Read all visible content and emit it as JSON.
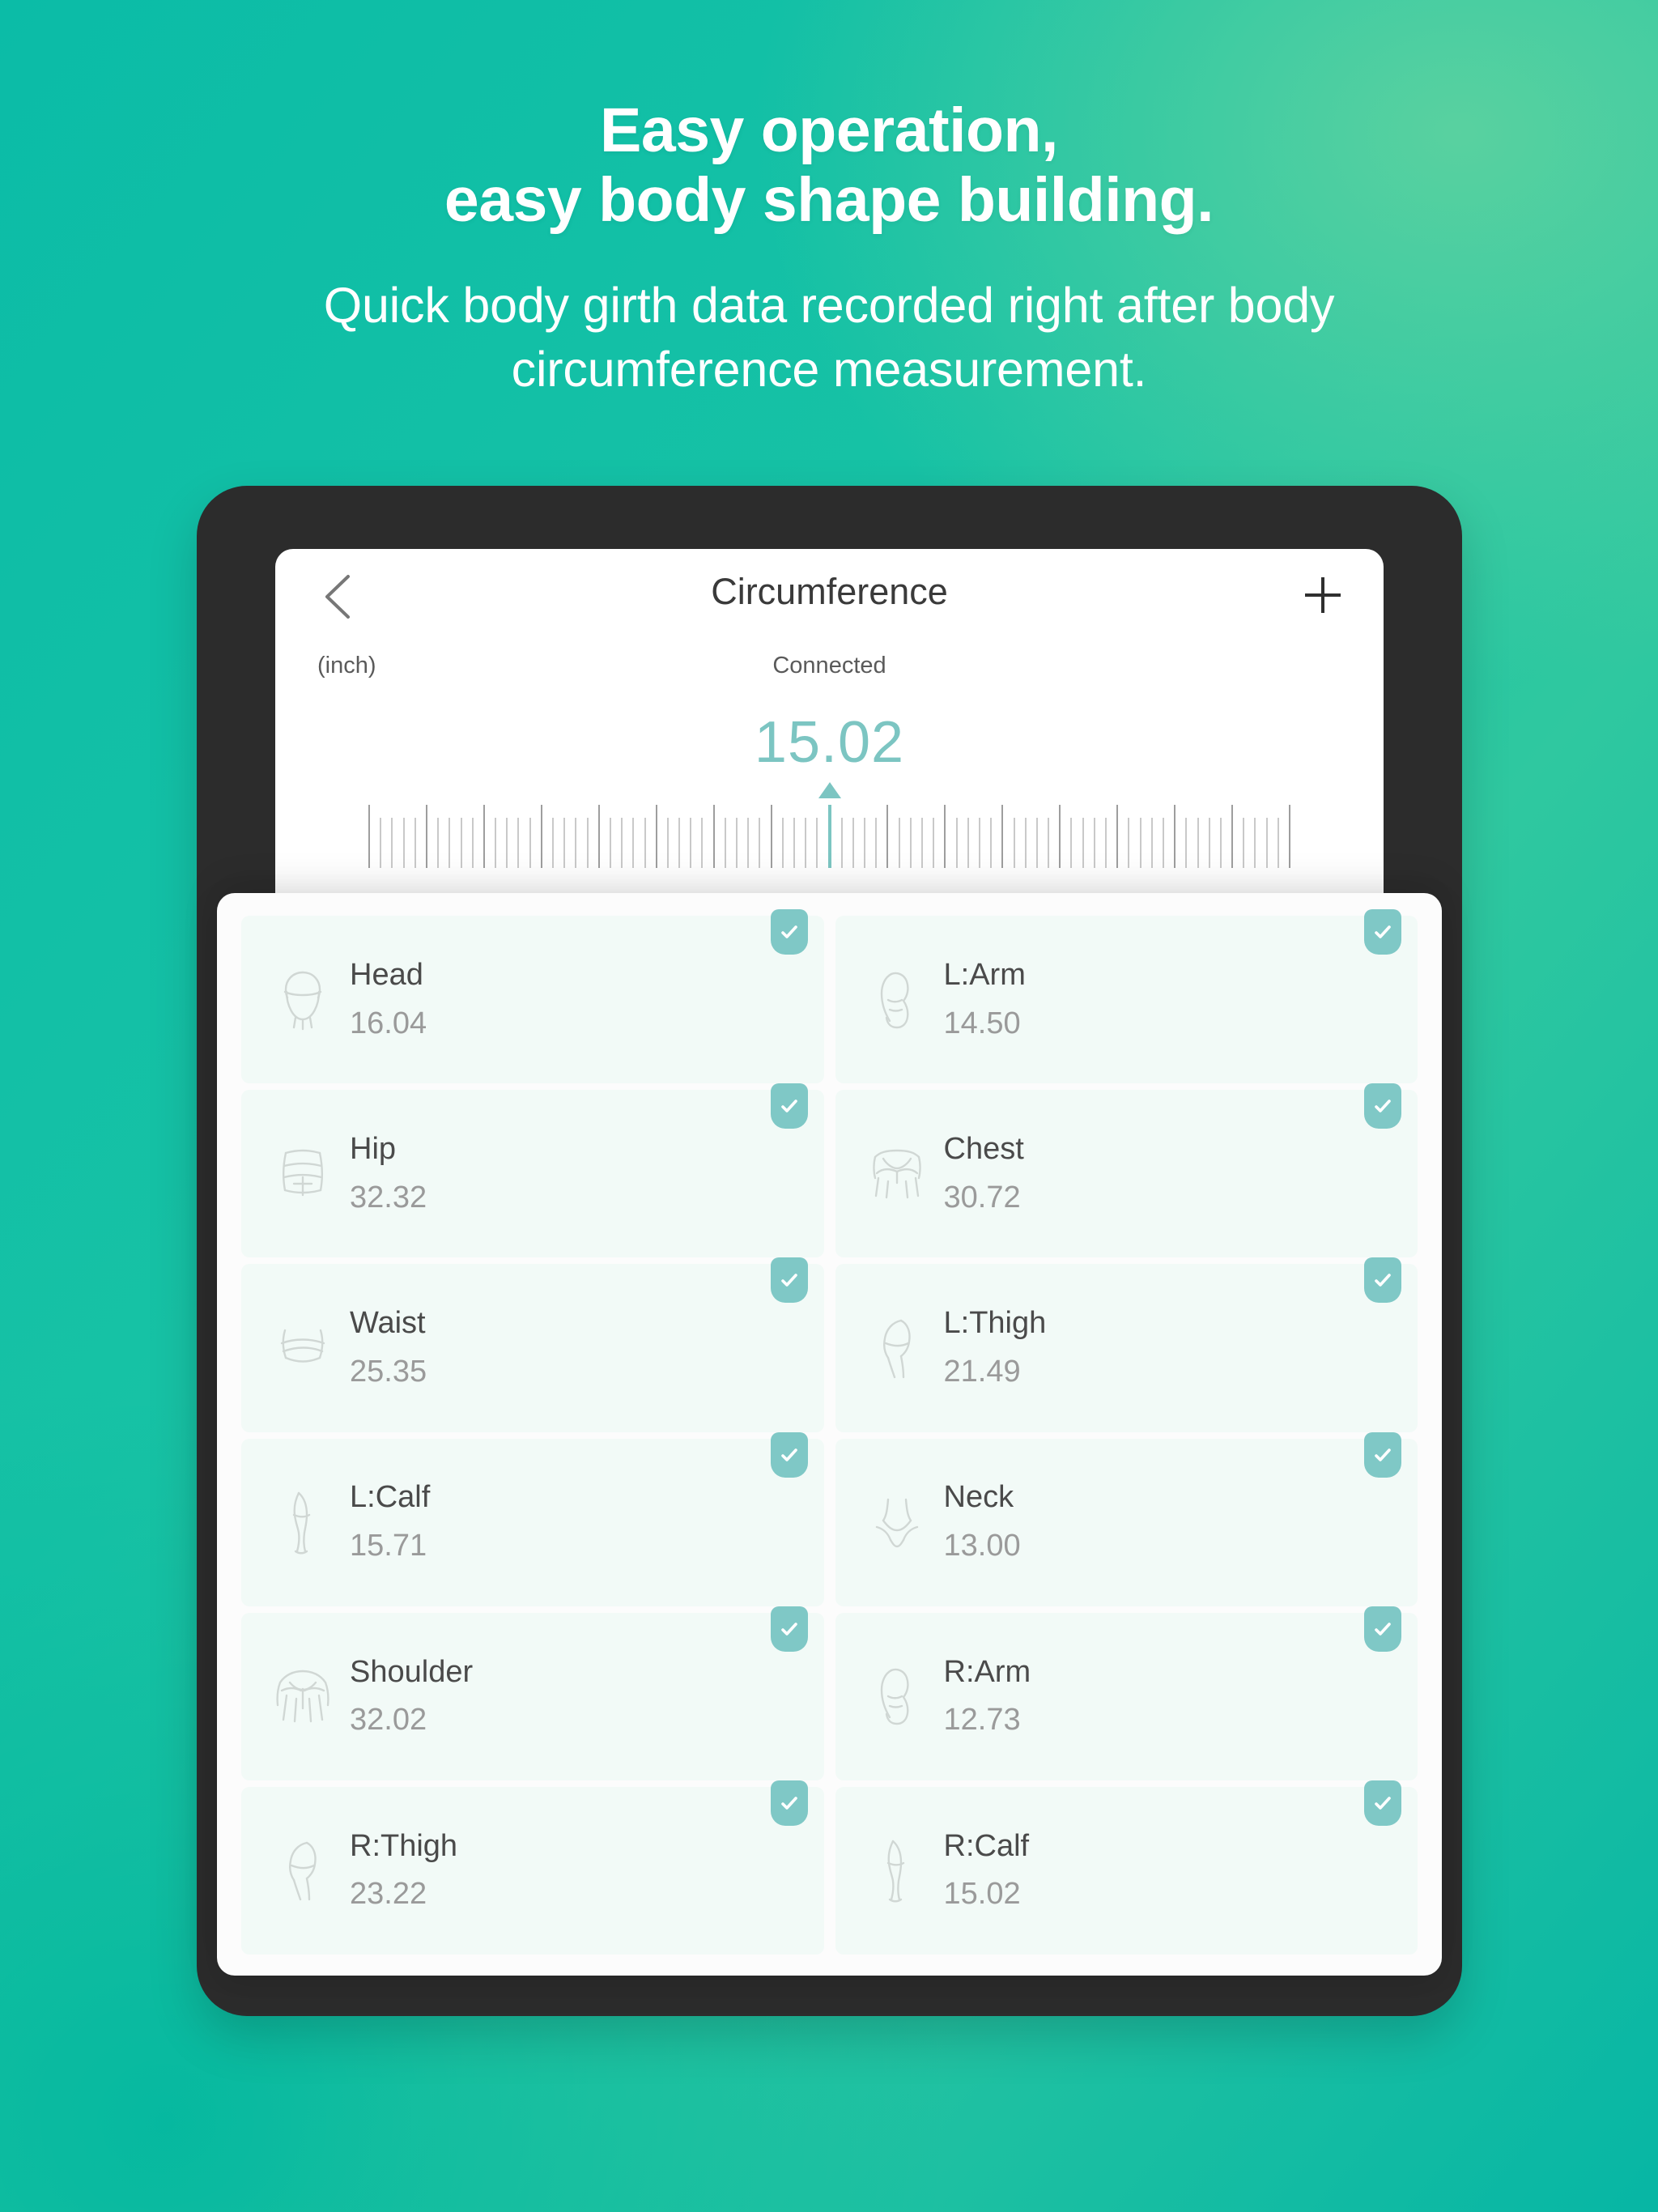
{
  "hero": {
    "headline_line1": "Easy operation,",
    "headline_line2": "easy body shape building.",
    "subhead_line1": "Quick body girth data recorded right after body",
    "subhead_line2": "circumference measurement."
  },
  "app": {
    "nav": {
      "back_icon": "chevron-left-icon",
      "title": "Circumference",
      "add_icon": "plus-icon"
    },
    "unit_label": "(inch)",
    "status_label": "Connected",
    "reading_value": "15.02",
    "confirm_label": "",
    "accent_color": "#7CC5C2",
    "bezel_color": "#2C2C2C",
    "background_top_left": "#0BBCA7",
    "background_top_right": "#3DC79E"
  },
  "measurements": [
    {
      "icon": "head-icon",
      "name": "Head",
      "value": "16.04",
      "checked": true
    },
    {
      "icon": "arm-icon",
      "name": "L:Arm",
      "value": "14.50",
      "checked": true
    },
    {
      "icon": "hip-icon",
      "name": "Hip",
      "value": "32.32",
      "checked": true
    },
    {
      "icon": "chest-icon",
      "name": "Chest",
      "value": "30.72",
      "checked": true
    },
    {
      "icon": "waist-icon",
      "name": "Waist",
      "value": "25.35",
      "checked": true
    },
    {
      "icon": "thigh-icon",
      "name": "L:Thigh",
      "value": "21.49",
      "checked": true
    },
    {
      "icon": "calf-icon",
      "name": "L:Calf",
      "value": "15.71",
      "checked": true
    },
    {
      "icon": "neck-icon",
      "name": "Neck",
      "value": "13.00",
      "checked": true
    },
    {
      "icon": "shoulder-icon",
      "name": "Shoulder",
      "value": "32.02",
      "checked": true
    },
    {
      "icon": "arm-icon",
      "name": "R:Arm",
      "value": "12.73",
      "checked": true
    },
    {
      "icon": "thigh-icon",
      "name": "R:Thigh",
      "value": "23.22",
      "checked": true
    },
    {
      "icon": "calf-icon",
      "name": "R:Calf",
      "value": "15.02",
      "checked": true
    }
  ]
}
